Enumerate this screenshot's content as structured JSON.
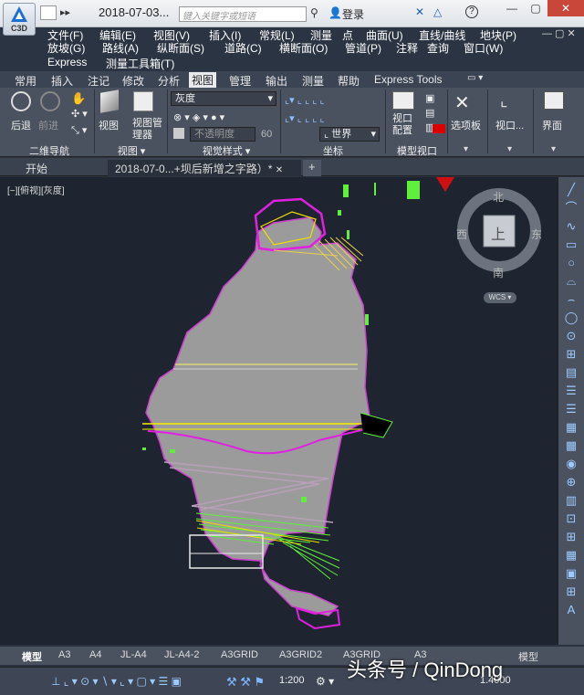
{
  "app": {
    "logo_text": "C3D",
    "doc_title": "2018-07-03...",
    "search_placeholder": "键入关键字或短语",
    "login": "登录"
  },
  "menus": {
    "row1": [
      "文件(F)",
      "编辑(E)",
      "视图(V)",
      "插入(I)",
      "常规(L)",
      "测量",
      "点",
      "曲面(U)",
      "直线/曲线",
      "地块(P)"
    ],
    "row2": [
      "放坡(G)",
      "路线(A)",
      "纵断面(S)",
      "道路(C)",
      "横断面(O)",
      "管道(P)",
      "注释",
      "查询",
      "窗口(W)"
    ],
    "row3": [
      "Express",
      "测量工具箱(T)"
    ]
  },
  "ribbon_tabs": [
    "常用",
    "插入",
    "注记",
    "修改",
    "分析",
    "视图",
    "管理",
    "输出",
    "测量",
    "帮助",
    "Express Tools"
  ],
  "active_tab": "视图",
  "ribbon": {
    "nav_back": "后退",
    "nav_forward": "前进",
    "panel_nav": "二维导航",
    "view_btn": "视图",
    "view_mgr": "视图管理器",
    "panel_view": "视图 ▾",
    "visual_style": "灰度",
    "opacity_placeholder": "不透明度",
    "opacity_value": "60",
    "panel_visual": "视觉样式 ▾",
    "ucs_world": "世界",
    "panel_coord": "坐标",
    "viewport_config": "视口配置",
    "panel_model_vp": "模型视口",
    "palettes": "选项板",
    "viewport": "视口...",
    "interface": "界面"
  },
  "doc_tabs": {
    "start": "开始",
    "current": "2018-07-0...+坝后新增之字路）*"
  },
  "viewport_label": "[−][俯视][灰度]",
  "viewcube": {
    "north": "北",
    "south": "南",
    "east": "东",
    "west": "西",
    "top": "上",
    "wcs": "WCS"
  },
  "layout_tabs": [
    "模型",
    "A3",
    "A4",
    "JL-A4",
    "JL-A4-2",
    "A3GRID",
    "A3GRID2",
    "A3GRID",
    "A3"
  ],
  "status": {
    "scale": "1:200",
    "value": "1.4000",
    "model": "模型"
  },
  "watermark": "头条号 / QinDong",
  "colors": {
    "menubar": "#2b3442",
    "ribbon": "#4a5260",
    "canvas": "#1f2530",
    "drawing_gray": "#9a9a9a",
    "magenta": "#e020e0",
    "green": "#5ef03a",
    "yellow": "#f4f000"
  }
}
